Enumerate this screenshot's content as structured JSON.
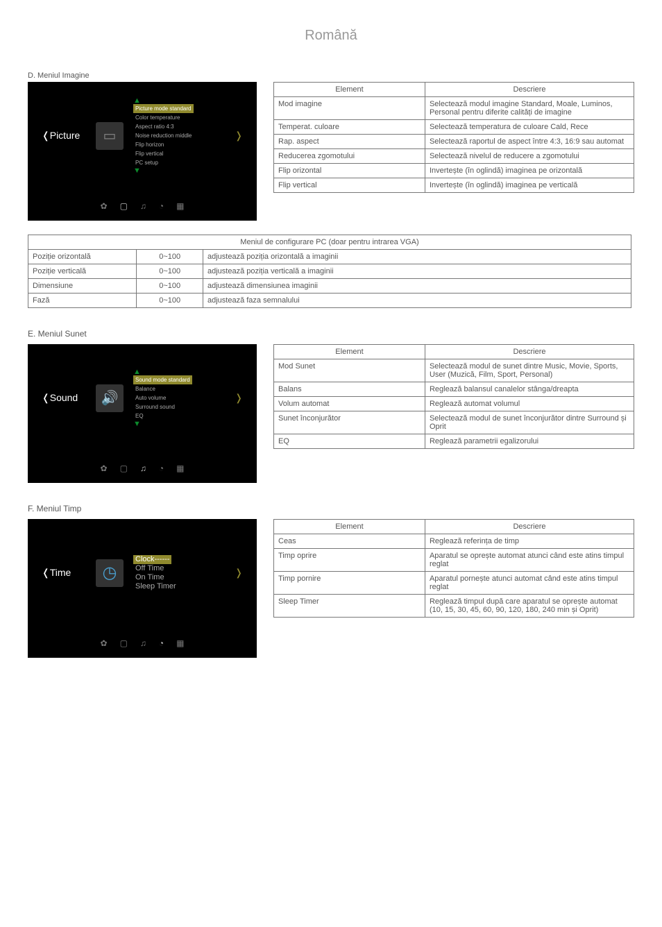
{
  "header": "Română",
  "picture_section_label": "D. Meniul Imagine",
  "picture_menu": {
    "label": "❬Picture",
    "items": [
      "Picture mode standard",
      "Color temperature",
      "Aspect ratio 4:3",
      "Noise reduction middle",
      "Flip horizon",
      "Flip vertical",
      "PC setup"
    ]
  },
  "picture_table": {
    "header": [
      "Element",
      "Descriere"
    ],
    "rows": [
      [
        "Mod imagine",
        "Selectează modul imagine Standard, Moale, Luminos, Personal pentru diferite calități de imagine"
      ],
      [
        "Temperat. culoare",
        "Selectează temperatura de culoare Cald, Rece"
      ],
      [
        "Rap. aspect",
        "Selectează raportul de aspect între 4:3, 16:9 sau automat"
      ],
      [
        "Reducerea zgomotului",
        "Selectează nivelul de reducere a zgomotului"
      ],
      [
        "Flip orizontal",
        "Invertește (în oglindă) imaginea pe orizontală"
      ],
      [
        "Flip vertical",
        "Invertește (în oglindă) imaginea pe verticală"
      ]
    ]
  },
  "pc_caption": "Meniul de configurare PC (doar pentru intrarea VGA)",
  "pc_table": {
    "rows": [
      [
        "Poziție orizontală",
        "0~100",
        "adjustează poziția orizontală a imaginii"
      ],
      [
        "Poziție verticală",
        "0~100",
        "adjustează poziția verticală a imaginii"
      ],
      [
        "Dimensiune",
        "0~100",
        "adjustează dimensiunea imaginii"
      ],
      [
        "Fază",
        "0~100",
        "adjustează faza semnalului"
      ]
    ]
  },
  "sound_section_label": "E. Meniul Sunet",
  "sound_menu": {
    "label": "❬Sound",
    "items": [
      "Sound mode standard",
      "Balance",
      "Auto volume",
      "Surround sound",
      "EQ"
    ]
  },
  "sound_table": {
    "header": [
      "Element",
      "Descriere"
    ],
    "rows": [
      [
        "Mod Sunet",
        "Selectează modul de sunet dintre Music, Movie, Sports, User (Muzică, Film, Sport, Personal)"
      ],
      [
        "Balans",
        "Reglează balansul canalelor stânga/dreapta"
      ],
      [
        "Volum automat",
        "Reglează automat volumul"
      ],
      [
        "Sunet înconjurător",
        "Selectează modul de sunet înconjurător dintre Surround și Oprit"
      ],
      [
        "EQ",
        "Reglează parametrii egalizorului"
      ]
    ]
  },
  "time_section_label": "F. Meniul Timp",
  "time_menu": {
    "label": "❬Time",
    "items": [
      "Clock------",
      "Off Time",
      "On Time",
      "Sleep Timer"
    ]
  },
  "time_table": {
    "header": [
      "Element",
      "Descriere"
    ],
    "rows": [
      [
        "Ceas",
        "Reglează referința de timp"
      ],
      [
        "Timp oprire",
        "Aparatul se oprește automat atunci când este atins timpul reglat"
      ],
      [
        "Timp pornire",
        "Aparatul pornește atunci automat când este atins timpul reglat"
      ],
      [
        "Sleep Timer",
        "Reglează timpul după care aparatul se oprește automat (10, 15, 30, 45, 60, 90, 120, 180, 240 min și Oprit)"
      ]
    ]
  }
}
